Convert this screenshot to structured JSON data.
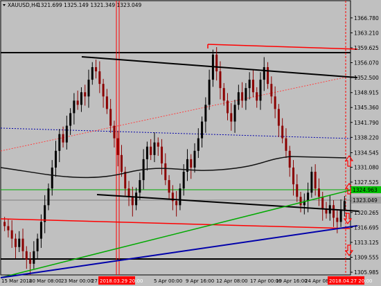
{
  "header": {
    "symbol_tf": "XAUUSD,H4",
    "ohlc": "1321.699 1325.149 1321.349 1323.049"
  },
  "colors": {
    "background": "#c0c0c0",
    "bull": "#000000",
    "bear": "#8b0000",
    "trend_black": "#000000",
    "trend_red": "#ff0000",
    "trend_green": "#00aa00",
    "trend_blue": "#0000aa",
    "ma": "#111111",
    "label_green_bg": "#00c000",
    "label_gray_bg": "#a0a0a0",
    "date_label_bg": "#ff0000"
  },
  "price_labels": {
    "green": "1324.963",
    "current": "1323.049"
  },
  "time_labels": {
    "left": "2018.03.29 20:00",
    "right": "2018.04.27 20:00"
  },
  "chart_data": {
    "type": "candlestick",
    "symbol": "XAUUSD",
    "timeframe": "H4",
    "ylim": [
      1305.5,
      1369.4
    ],
    "y_ticks": [
      "1366.780",
      "1363.210",
      "1359.625",
      "1356.070",
      "1352.500",
      "1348.915",
      "1345.360",
      "1341.790",
      "1338.220",
      "1334.545",
      "1331.080",
      "1327.525",
      "1324.963",
      "1323.049",
      "1320.265",
      "1316.695",
      "1313.125",
      "1309.555",
      "1305.985"
    ],
    "x_ticks": [
      "15 Mar 2018",
      "20 Mar 08:00",
      "23 Mar 00:00",
      "27",
      "2018.03.29 20:00",
      "5 Apr 00:00",
      "9 Apr 16:00",
      "12 Apr 08:00",
      "17 Apr 00:00",
      "19 Apr 16:00",
      "24 Apr 08:00",
      "2018.04.27 20:00"
    ],
    "closes": [
      1317,
      1316,
      1314,
      1312,
      1314,
      1311,
      1309,
      1308,
      1311,
      1314,
      1318,
      1322,
      1326,
      1331,
      1335,
      1339,
      1337,
      1341,
      1344,
      1347,
      1346,
      1349,
      1348,
      1352,
      1355,
      1354,
      1351,
      1348,
      1345,
      1341,
      1338,
      1334,
      1330,
      1326,
      1324,
      1322,
      1325,
      1328,
      1333,
      1336,
      1334,
      1337,
      1336,
      1332,
      1328,
      1325,
      1323,
      1322,
      1326,
      1330,
      1333,
      1331,
      1335,
      1338,
      1342,
      1346,
      1352,
      1358,
      1354,
      1350,
      1347,
      1344,
      1342,
      1346,
      1349,
      1347,
      1350,
      1352,
      1349,
      1347,
      1352,
      1355,
      1351,
      1348,
      1345,
      1341,
      1338,
      1335,
      1331,
      1327,
      1324,
      1322,
      1323,
      1325,
      1330,
      1326,
      1324,
      1321,
      1320,
      1322,
      1319,
      1318,
      1321,
      1323
    ]
  }
}
